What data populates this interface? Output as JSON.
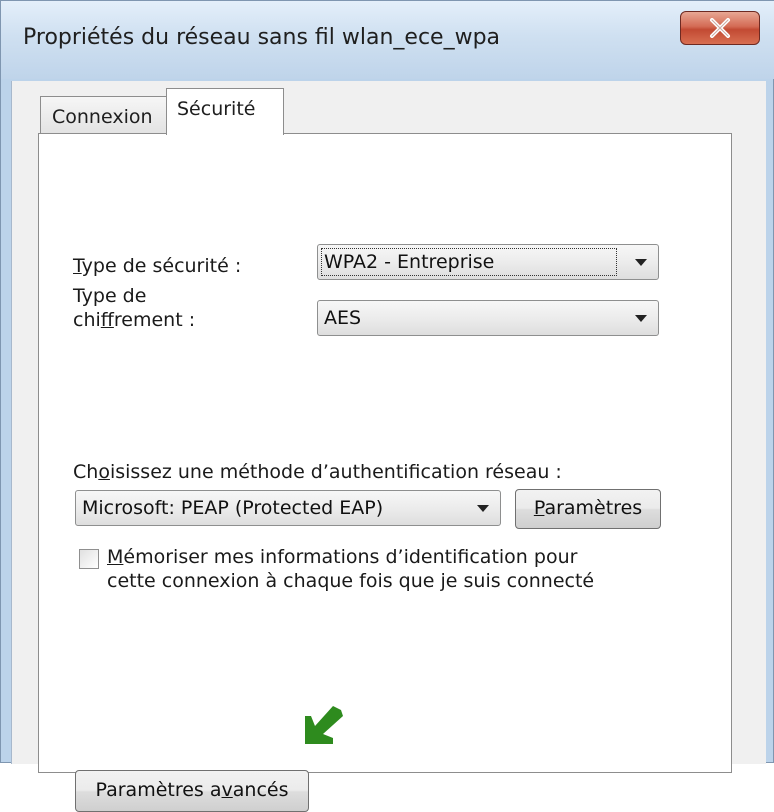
{
  "window": {
    "title": "Propriétés du réseau sans fil wlan_ece_wpa",
    "close_symbol": "X"
  },
  "tabs": [
    {
      "label": "Connexion",
      "selected": false
    },
    {
      "label": "Sécurité",
      "selected": true
    }
  ],
  "security": {
    "type_label_prefix": "T",
    "type_label_rest": "ype de sécurité :",
    "type_value": "WPA2 - Entreprise",
    "cipher_label_line1": "Type de",
    "cipher_label_line2_a": "chi",
    "cipher_label_line2_u": "f",
    "cipher_label_line2_b": "frement :",
    "cipher_value": "AES"
  },
  "auth": {
    "label_a": "Ch",
    "label_u": "o",
    "label_b": "isissez une méthode d’authentification réseau :",
    "method_value": "Microsoft: PEAP (Protected EAP)",
    "settings_button_u": "P",
    "settings_button_rest": "aramètres"
  },
  "remember": {
    "checked": false,
    "line1_u": "M",
    "line1_rest": "émoriser mes informations d’identification pour",
    "line2": "cette connexion à chaque fois que je suis connecté"
  },
  "advanced": {
    "label_a": "Paramètres a",
    "label_u": "v",
    "label_b": "ancés"
  },
  "icons": {
    "close": "close-icon",
    "dropdown": "chevron-down-icon",
    "pointer": "arrow-pointer-icon"
  },
  "colors": {
    "pointer_arrow": "#2e8b1e",
    "close_button": "#c9503a"
  }
}
